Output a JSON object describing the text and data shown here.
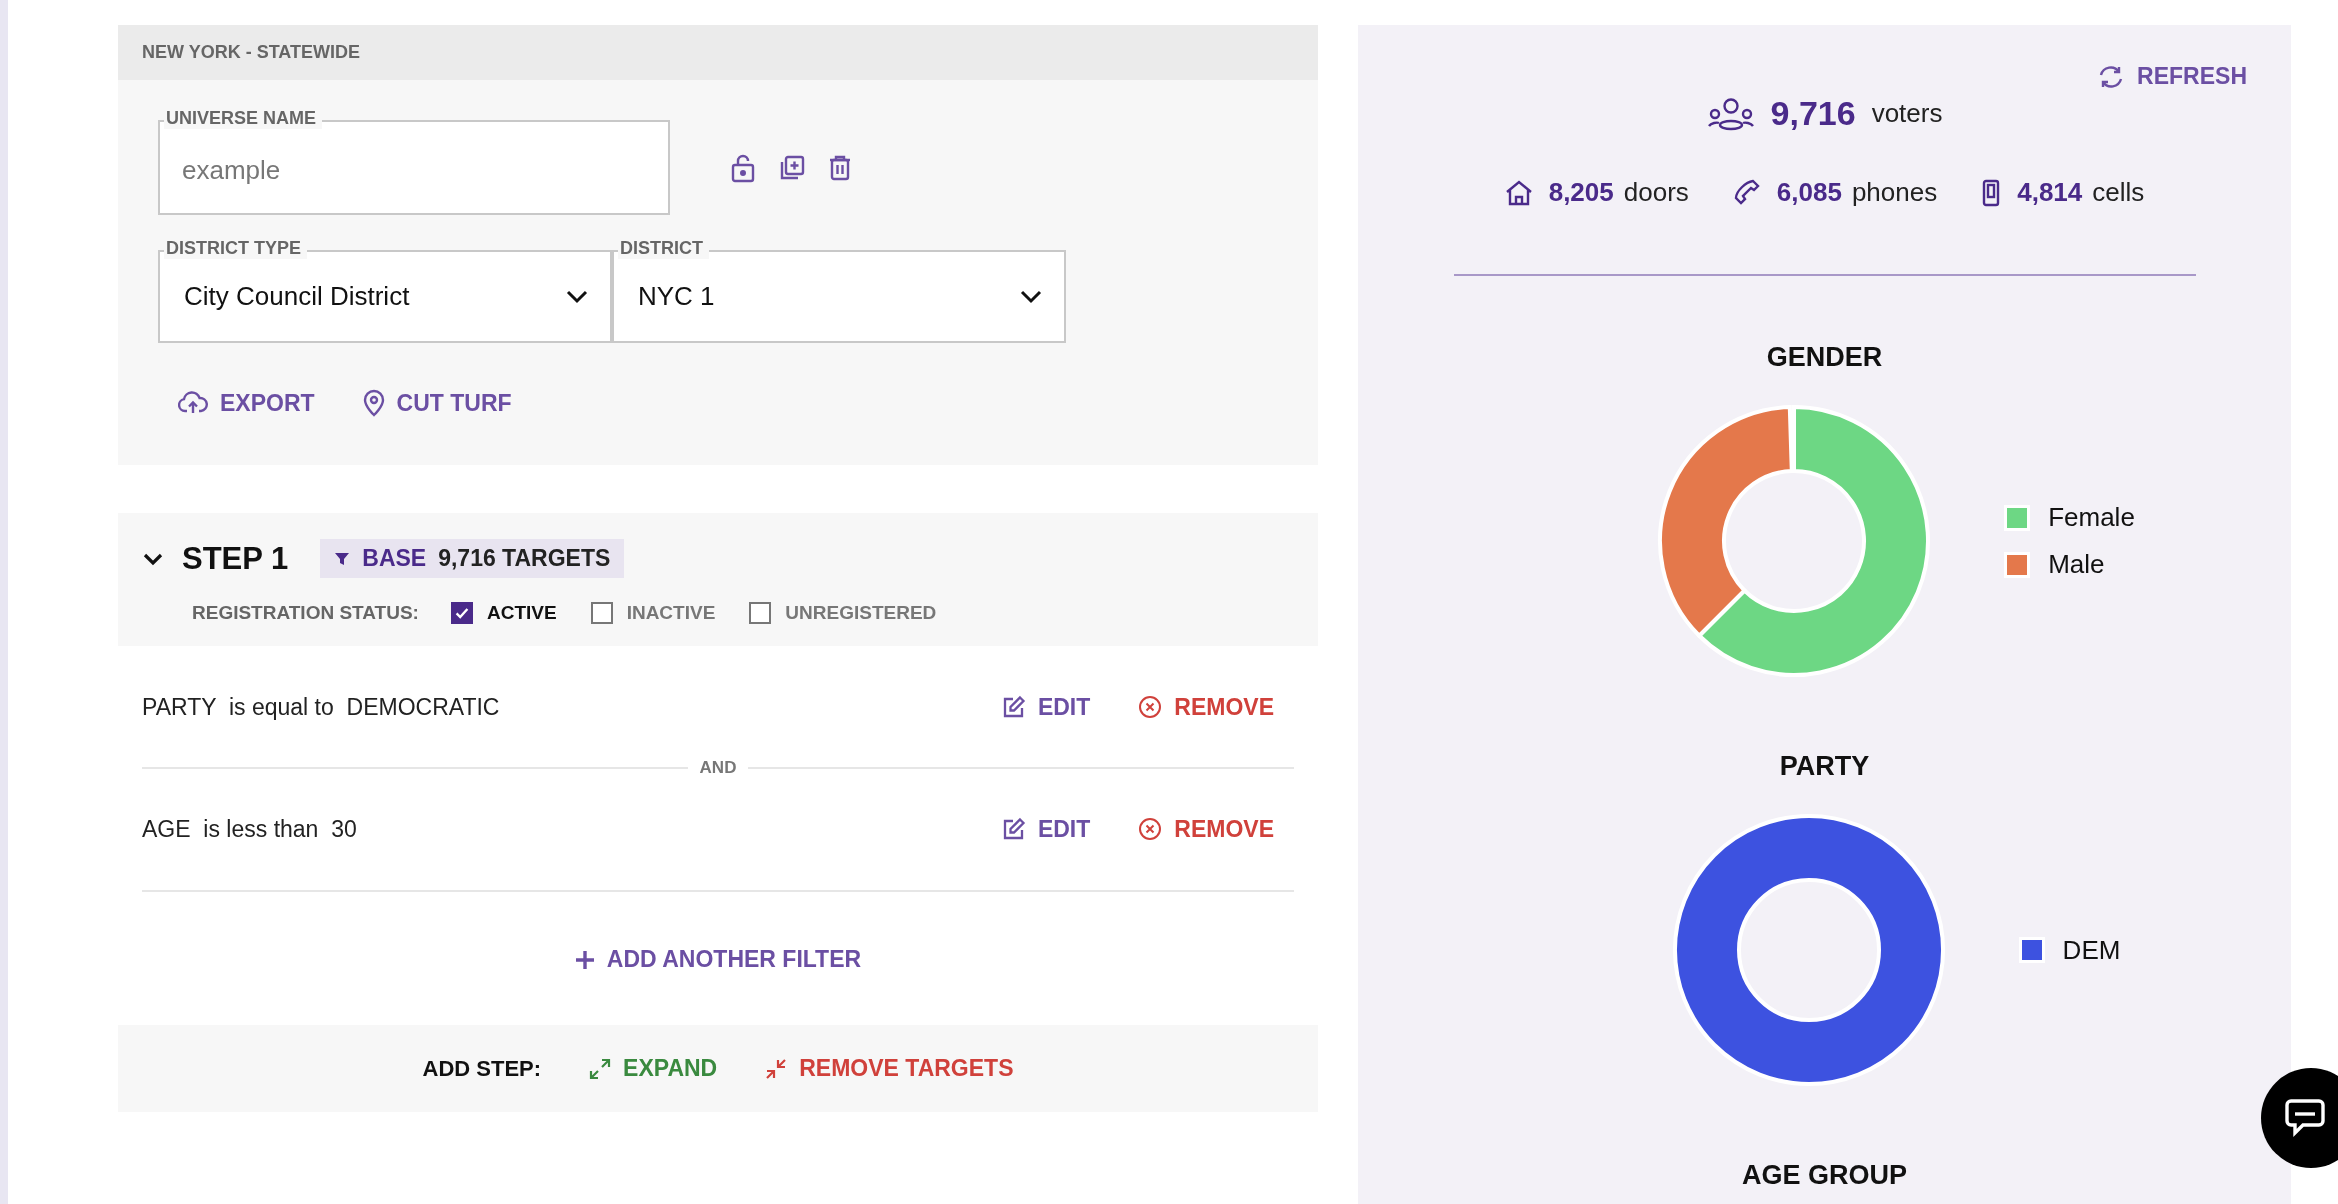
{
  "header": {
    "title": "NEW YORK - STATEWIDE"
  },
  "universe_name": {
    "label": "UNIVERSE NAME",
    "placeholder": "example"
  },
  "selects": [
    {
      "label": "DISTRICT TYPE",
      "value": "City Council District"
    },
    {
      "label": "DISTRICT",
      "value": "NYC 1"
    }
  ],
  "actions": [
    {
      "kind": "export",
      "label": "EXPORT"
    },
    {
      "kind": "cut_turf",
      "label": "CUT TURF"
    }
  ],
  "step": {
    "title": "STEP 1",
    "expanded": true,
    "badge": {
      "label": "BASE",
      "count": "9,716 TARGETS"
    },
    "registration": {
      "label": "REGISTRATION STATUS:",
      "options": [
        {
          "label": "ACTIVE",
          "checked": true
        },
        {
          "label": "INACTIVE",
          "checked": false
        },
        {
          "label": "UNREGISTERED",
          "checked": false
        }
      ]
    },
    "filters": [
      {
        "text": "PARTY  is equal to  DEMOCRATIC",
        "edit": "EDIT",
        "remove": "REMOVE"
      },
      {
        "text": "AGE  is less than  30",
        "edit": "EDIT",
        "remove": "REMOVE"
      }
    ],
    "connector": "AND",
    "add_filter": "ADD ANOTHER FILTER"
  },
  "add_step": {
    "label": "ADD STEP:",
    "actions": [
      {
        "kind": "expand",
        "label": "EXPAND"
      },
      {
        "kind": "remove",
        "label": "REMOVE TARGETS"
      }
    ]
  },
  "summary": {
    "refresh": "REFRESH",
    "voters": {
      "count": "9,716",
      "unit": "voters"
    },
    "stats": [
      {
        "kind": "doors",
        "count": "8,205",
        "unit": "doors"
      },
      {
        "kind": "phones",
        "count": "6,085",
        "unit": "phones"
      },
      {
        "kind": "cells",
        "count": "4,814",
        "unit": "cells"
      }
    ]
  },
  "charts": [
    {
      "title": "GENDER",
      "legend": [
        {
          "label": "Female",
          "color": "#6dd784"
        },
        {
          "label": "Male",
          "color": "#e4784b"
        }
      ]
    },
    {
      "title": "PARTY",
      "legend": [
        {
          "label": "DEM",
          "color": "#3d52e0"
        }
      ]
    },
    {
      "title": "AGE GROUP"
    }
  ]
}
